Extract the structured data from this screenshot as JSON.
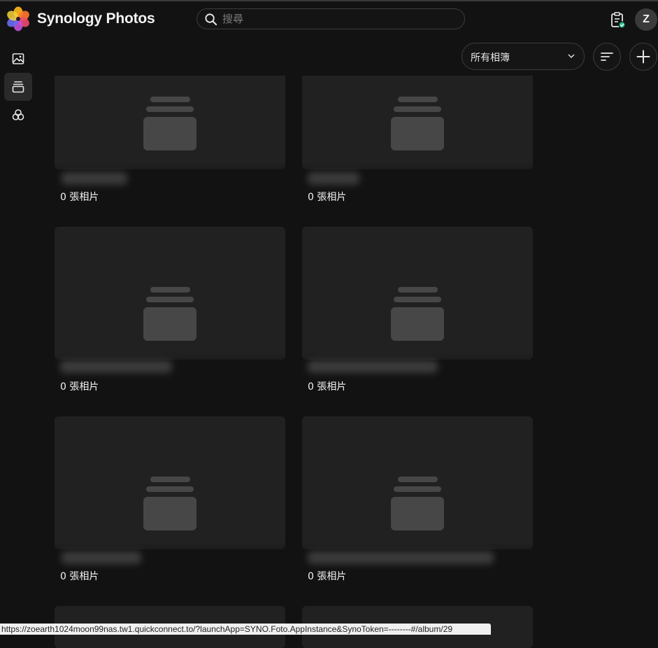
{
  "header": {
    "app_title": "Synology Photos",
    "search_placeholder": "搜尋",
    "user_initial": "Z"
  },
  "sidebar": {
    "items": [
      {
        "name": "photos",
        "icon": "image-icon",
        "active": false
      },
      {
        "name": "albums",
        "icon": "albums-icon",
        "active": true
      },
      {
        "name": "shared",
        "icon": "shared-circles-icon",
        "active": false
      }
    ]
  },
  "toolbar": {
    "album_filter_value": "所有相簿",
    "sort_icon": "sort-icon",
    "add_icon": "plus-icon"
  },
  "albums": [
    {
      "photo_count": "0 張相片"
    },
    {
      "photo_count": "0 張相片"
    },
    {
      "photo_count": "0 張相片"
    },
    {
      "photo_count": "0 張相片"
    },
    {
      "photo_count": "0 張相片"
    },
    {
      "photo_count": "0 張相片"
    }
  ],
  "statusbar": {
    "url": "https://zoearth1024moon99nas.tw1.quickconnect.to/?launchApp=SYNO.Foto.AppInstance&SynoToken=--------#/album/29"
  },
  "colors": {
    "background": "#121212",
    "card": "#212121",
    "placeholder": "#474747",
    "badge_check": "#22c08a"
  }
}
